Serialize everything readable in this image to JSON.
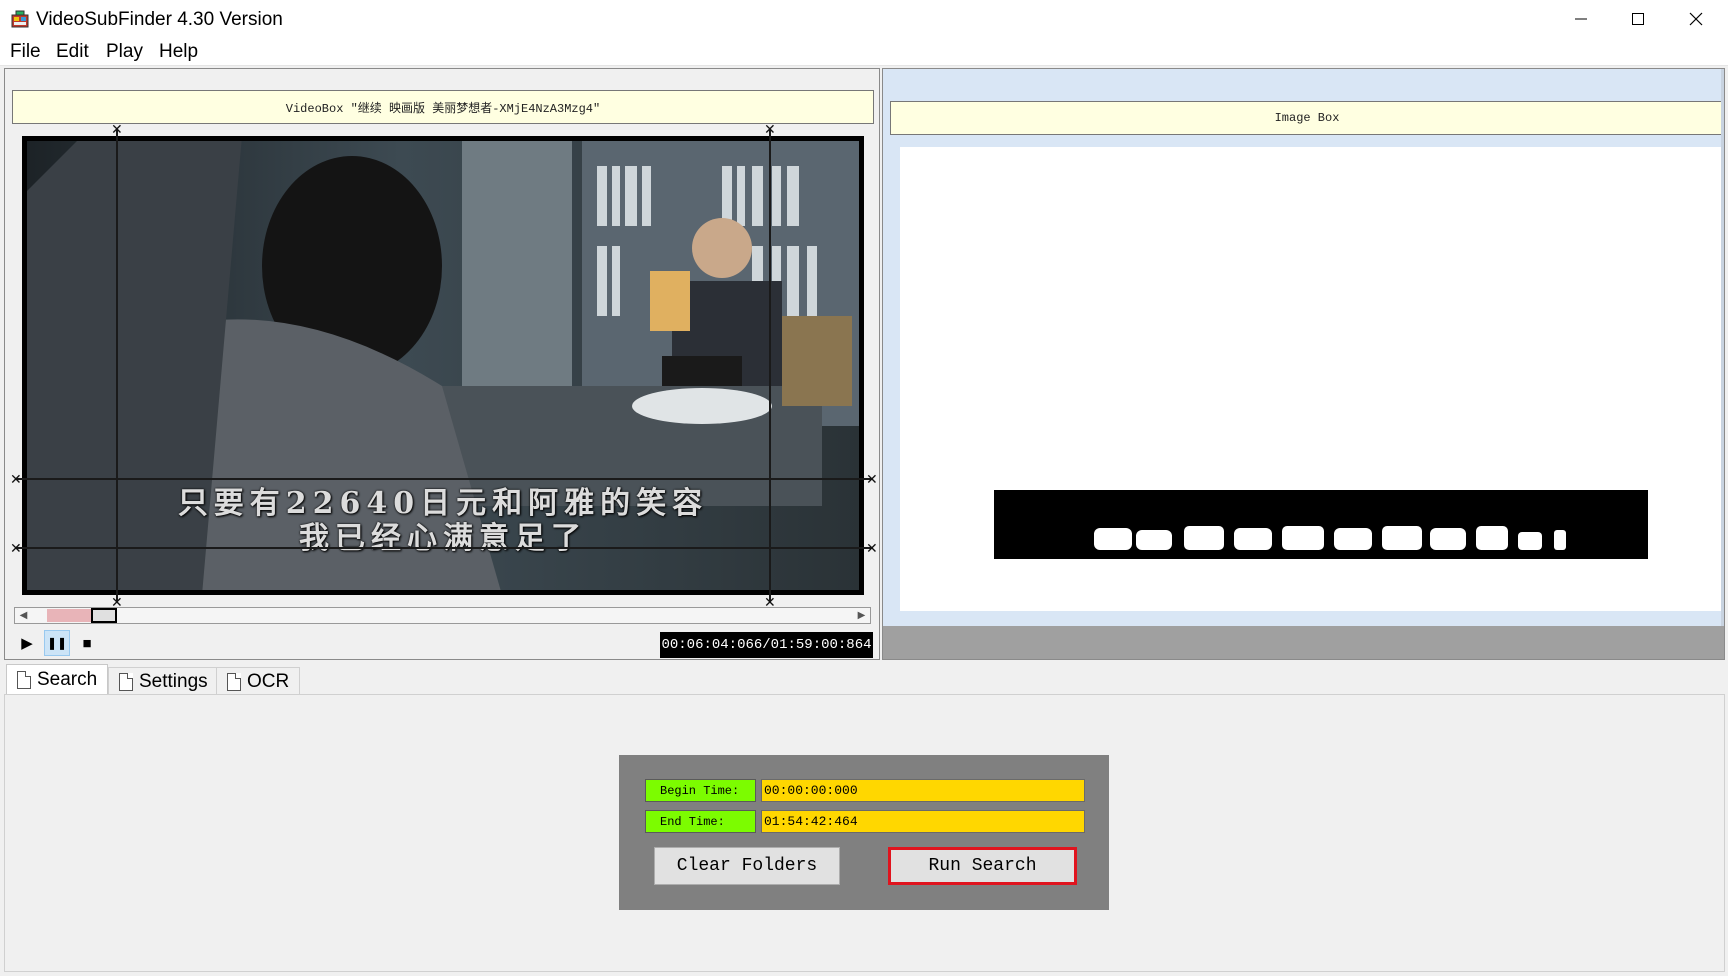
{
  "window": {
    "title": "VideoSubFinder 4.30 Version",
    "minimize_glyph": "—",
    "maximize_glyph": "☐",
    "close_glyph": "✕",
    "app_icon": "videosubfinder-app-icon"
  },
  "menu": {
    "items": [
      "File",
      "Edit",
      "Play",
      "Help"
    ]
  },
  "video_box": {
    "caption": "VideoBox \"继续 映画版 美丽梦想者-XMjE4NzA3Mzg4\"",
    "subtitle_line1": "只要有22640日元和阿雅的笑容",
    "subtitle_line2": "我已经心满意足了",
    "progress_fraction": 0.047,
    "time_display": "00:06:04:066/01:59:00:864",
    "controls": {
      "play_icon": "▶",
      "pause_icon": "❚❚",
      "stop_icon": "■"
    },
    "scroll_left_glyph": "◀",
    "scroll_right_glyph": "▶",
    "guide_marker_glyph": "✕"
  },
  "image_box": {
    "caption": "Image Box"
  },
  "tabs": [
    {
      "label": "Search",
      "active": true
    },
    {
      "label": "Settings",
      "active": false
    },
    {
      "label": "OCR",
      "active": false
    }
  ],
  "search_panel": {
    "begin_time_label": "Begin Time:",
    "begin_time_value": "00:00:00:000",
    "end_time_label": "End Time:",
    "end_time_value": "01:54:42:464",
    "clear_folders_label": "Clear Folders",
    "run_search_label": "Run Search"
  },
  "colors": {
    "caption_bg": "#ffffe1",
    "label_green": "#7cfc00",
    "value_yellow": "#ffd700",
    "run_search_border": "#e0141e",
    "progress_pink": "#e8b4b8"
  }
}
